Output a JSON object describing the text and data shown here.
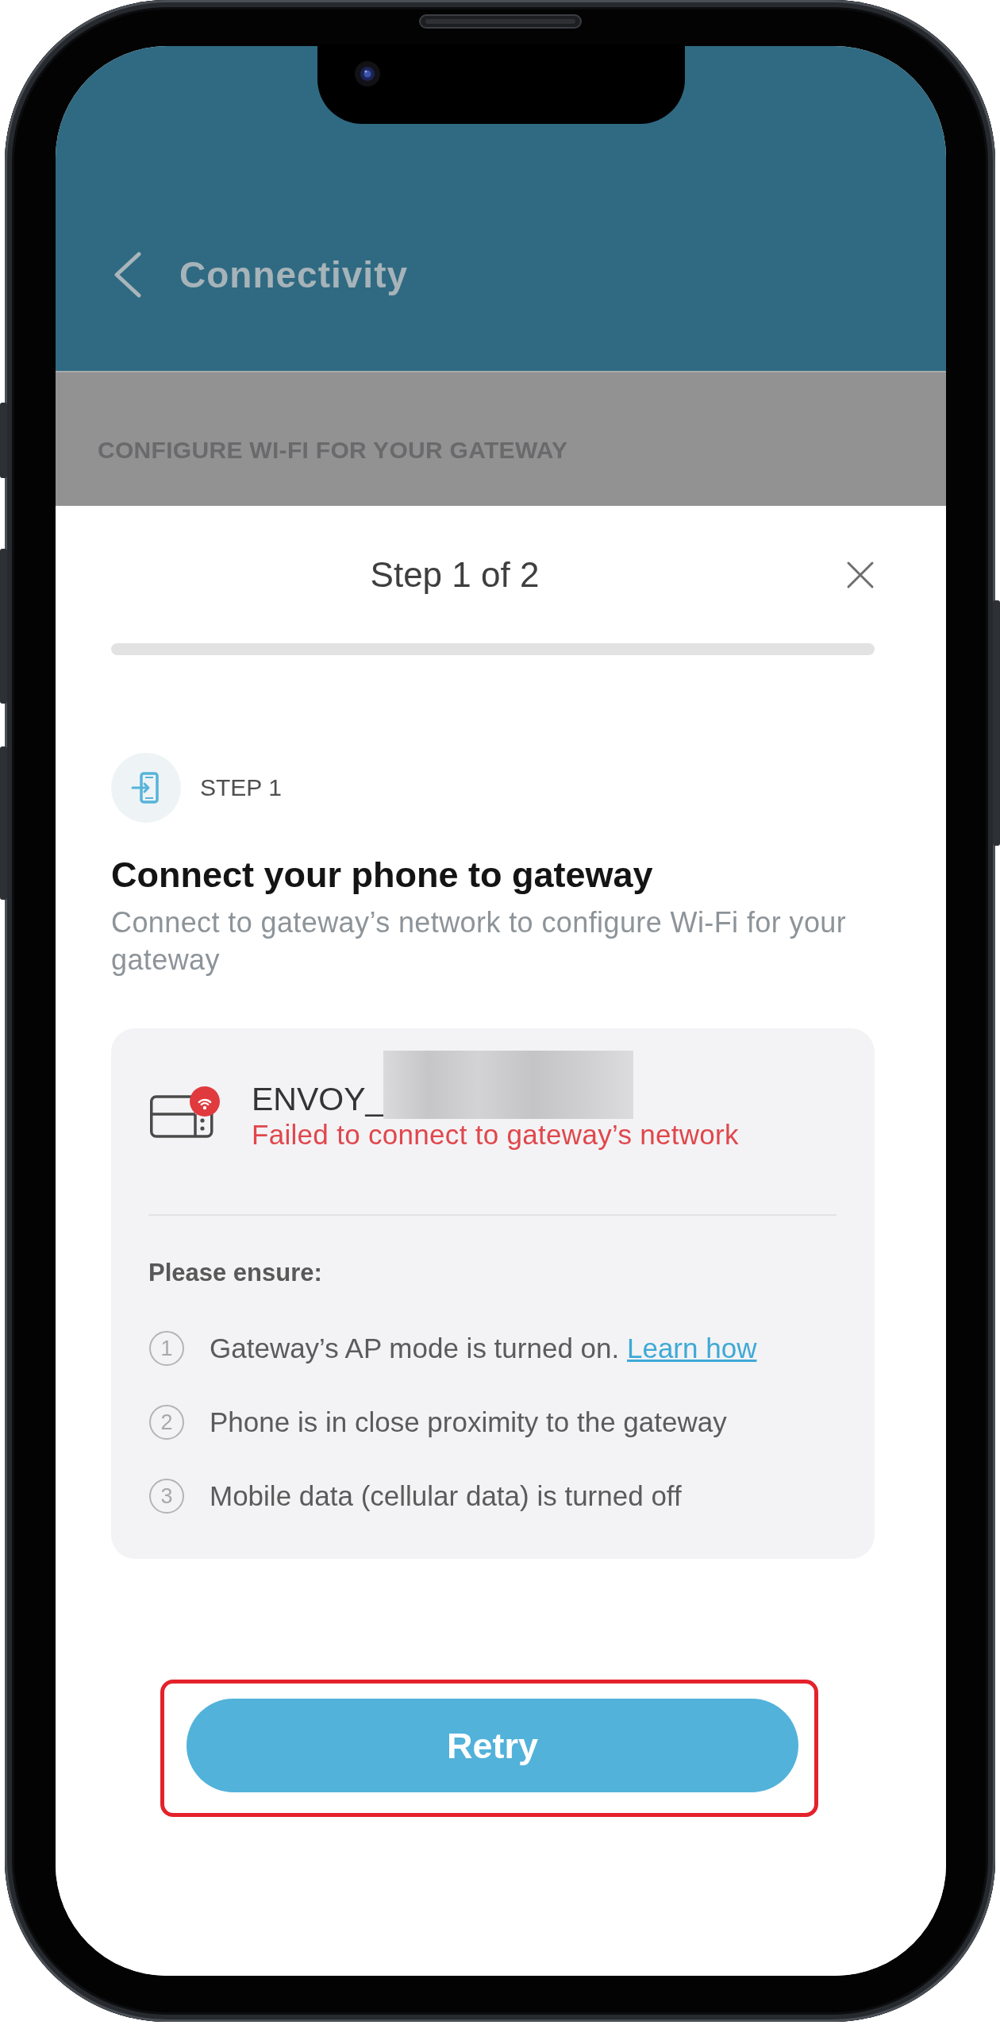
{
  "header": {
    "title": "Connectivity"
  },
  "section": {
    "title": "CONFIGURE WI-FI FOR YOUR GATEWAY"
  },
  "sheet": {
    "title": "Step 1 of 2",
    "progress": {
      "level": 0
    },
    "step": {
      "label": "STEP 1",
      "heading": "Connect your phone to gateway",
      "description": "Connect to gateway’s network to configure Wi-Fi for your gateway"
    },
    "network": {
      "name": "ENVOY_",
      "redacted": true,
      "connected": false,
      "status": "Failed to connect to gateway’s network",
      "checklist_title": "Please ensure:",
      "checklist": [
        {
          "number": "1",
          "text": "Gateway’s AP mode is turned on.",
          "link": "Learn how"
        },
        {
          "number": "2",
          "text": "Phone is in close proximity to the gateway"
        },
        {
          "number": "3",
          "text": "Mobile data (cellular data) is turned off"
        }
      ]
    },
    "retry_button": {
      "label": "Retry",
      "highlighted": true
    }
  }
}
